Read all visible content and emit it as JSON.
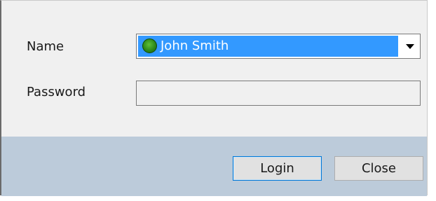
{
  "form": {
    "name_label": "Name",
    "password_label": "Password",
    "name_combo": {
      "selected_value": "John Smith",
      "status_icon": "green-status-dot-icon",
      "dropdown_icon": "chevron-down-icon"
    },
    "password_value": ""
  },
  "buttons": {
    "login_label": "Login",
    "close_label": "Close"
  },
  "colors": {
    "selection_highlight": "#3399ff",
    "footer_background": "#bccbda",
    "dialog_background": "#f0f0f0",
    "status_dot": "#2e8a1a"
  }
}
